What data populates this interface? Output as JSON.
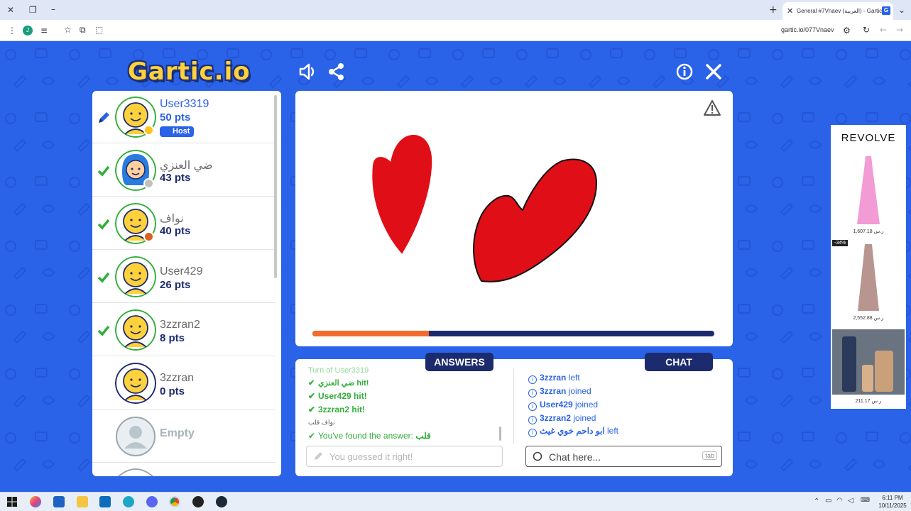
{
  "browser": {
    "tab_title": "General #7Vnaev (العربية) - Gartic",
    "url": "gartic.io/077Vnaev",
    "profile_initial": "J"
  },
  "game": {
    "logo": "Gartic.io"
  },
  "players": [
    {
      "name": "User3319",
      "pts": "50 pts",
      "badge": "Host",
      "mark": "pencil",
      "name_color": "#2a62e8"
    },
    {
      "name": "ضي العنزي",
      "pts": "43 pts",
      "mark": "check"
    },
    {
      "name": "نواف",
      "pts": "40 pts",
      "mark": "check"
    },
    {
      "name": "User429",
      "pts": "26 pts",
      "mark": "check"
    },
    {
      "name": "3zzran2",
      "pts": "8 pts",
      "mark": "check"
    },
    {
      "name": "3zzran",
      "pts": "0 pts",
      "mark": "none"
    },
    {
      "name": "Empty",
      "pts": "",
      "mark": "none"
    }
  ],
  "round_progress": 0.29,
  "tabs": {
    "answers": "ANSWERS",
    "chat": "CHAT"
  },
  "answers": {
    "turn_line": "Turn of User3319",
    "hits": [
      {
        "name": "ضي العنزي",
        "suffix": " hit!"
      },
      {
        "name": "User429",
        "suffix": " hit!"
      },
      {
        "name": "3zzran2",
        "suffix": " hit!"
      }
    ],
    "sub_line": "نواف قلب",
    "found_text": "You've found the answer: ",
    "found_word": "قلب",
    "input_placeholder": "You guessed it right!"
  },
  "chat": {
    "messages": [
      {
        "name": "3zzran",
        "action": " left"
      },
      {
        "name": "3zzran",
        "action": " joined"
      },
      {
        "name": "User429",
        "action": " joined"
      },
      {
        "name": "3zzran2",
        "action": " joined"
      },
      {
        "name": "ابو داحم خوي غيث",
        "action": " left"
      }
    ],
    "input_placeholder": "Chat here...",
    "tab_hint": "tab"
  },
  "ad": {
    "brand": "REVOLVE",
    "items": [
      {
        "price": "1,607.18 ر.س"
      },
      {
        "price": "2,552.88 ر.س",
        "discount": "-34%"
      },
      {
        "price": "211.17 ر.س"
      }
    ]
  },
  "taskbar": {
    "time": "6:11 PM",
    "date": "10/11/2025"
  }
}
